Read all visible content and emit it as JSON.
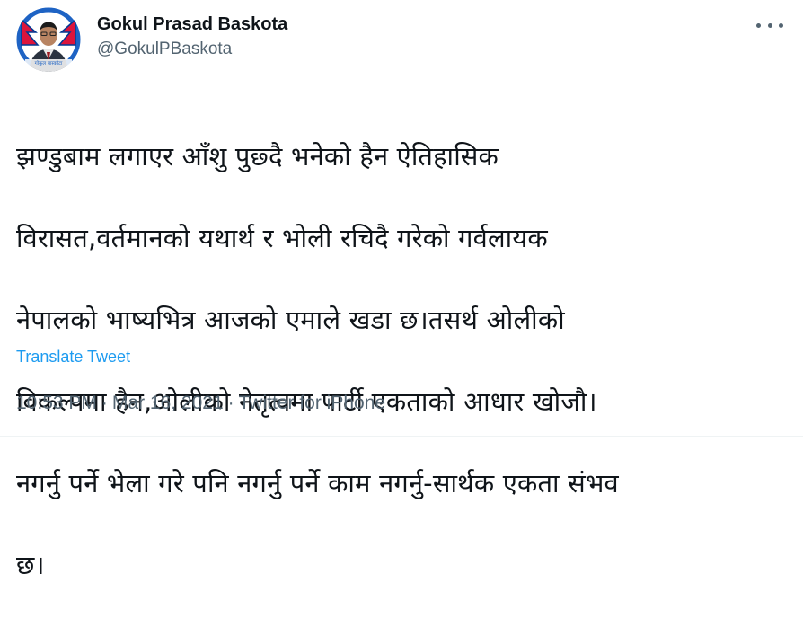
{
  "author": {
    "display_name": "Gokul Prasad Baskota",
    "handle": "@GokulPBaskota",
    "avatar_caption": "गोकुल बास्कोटा"
  },
  "tweet": {
    "lines": [
      "झण्डुबाम लगाएर आँशु पुछ्दै भनेको हैन ऐतिहासिक",
      "विरासत,वर्तमानको यथार्थ र भोली रचिदै गरेको गर्वलायक",
      "नेपालको भाष्यभित्र आजको एमाले खडा छ।तसर्थ ओलीको",
      "विकल्पमा हैन,ओलीको नेतृत्वमा पार्टी एकताको आधार खोजौ।",
      "नगर्नु पर्ने भेला गरे पनि नगर्नु पर्ने काम नगर्नु-सार्थक एकता संभव",
      "छ।"
    ],
    "translate_label": "Translate Tweet",
    "time": "10:53 PM",
    "date": "Mar 16, 2021",
    "source": "Twitter for iPhone",
    "separator": "·"
  },
  "icons": {
    "more": "more-horizontal-icon"
  },
  "colors": {
    "text": "#0f1419",
    "secondary": "#536471",
    "link": "#1d9bf0",
    "avatar_ring": "#1e63c4",
    "flag_red": "#dc143c",
    "flag_blue": "#003893"
  }
}
